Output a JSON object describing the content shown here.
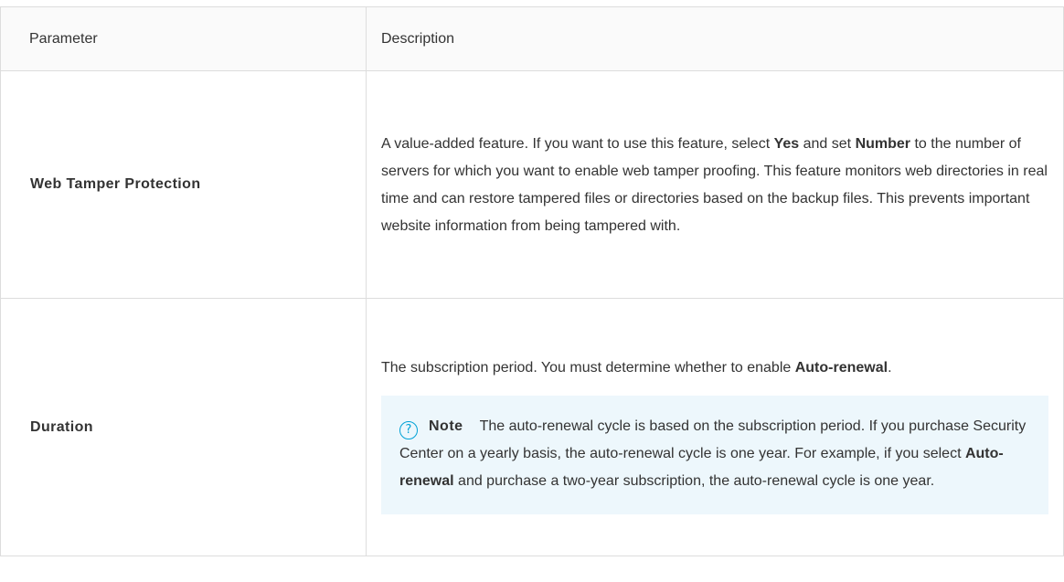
{
  "table": {
    "headers": {
      "parameter": "Parameter",
      "description": "Description"
    },
    "rows": {
      "web": {
        "name": "Web Tamper Protection",
        "desc": {
          "t1": "A value-added feature. If you want to use this feature, select ",
          "b1": "Yes",
          "t2": " and set ",
          "b2": "Number",
          "t3": " to the number of servers for which you want to enable web tamper proofing. This feature monitors web directories in real time and can restore tampered files or directories based on the backup files. This prevents important website information from being tampered with."
        }
      },
      "duration": {
        "name": "Duration",
        "desc": {
          "t1": "The subscription period. You must determine whether to enable ",
          "b1": "Auto-renewal",
          "t2": "."
        },
        "note": {
          "icon": "question-circle-icon",
          "icon_glyph": "?",
          "label": "Note",
          "t1": "The auto-renewal cycle is based on the subscription period. If you purchase Security Center on a yearly basis, the auto-renewal cycle is one year. For example, if you select ",
          "b1": "Auto-renewal",
          "t2": " and purchase a two-year subscription, the auto-renewal cycle is one year."
        }
      }
    }
  },
  "colors": {
    "border": "#dddddd",
    "header_bg": "#fafafa",
    "note_bg": "#edf7fc",
    "note_icon": "#00a1d6",
    "text": "#333333"
  }
}
